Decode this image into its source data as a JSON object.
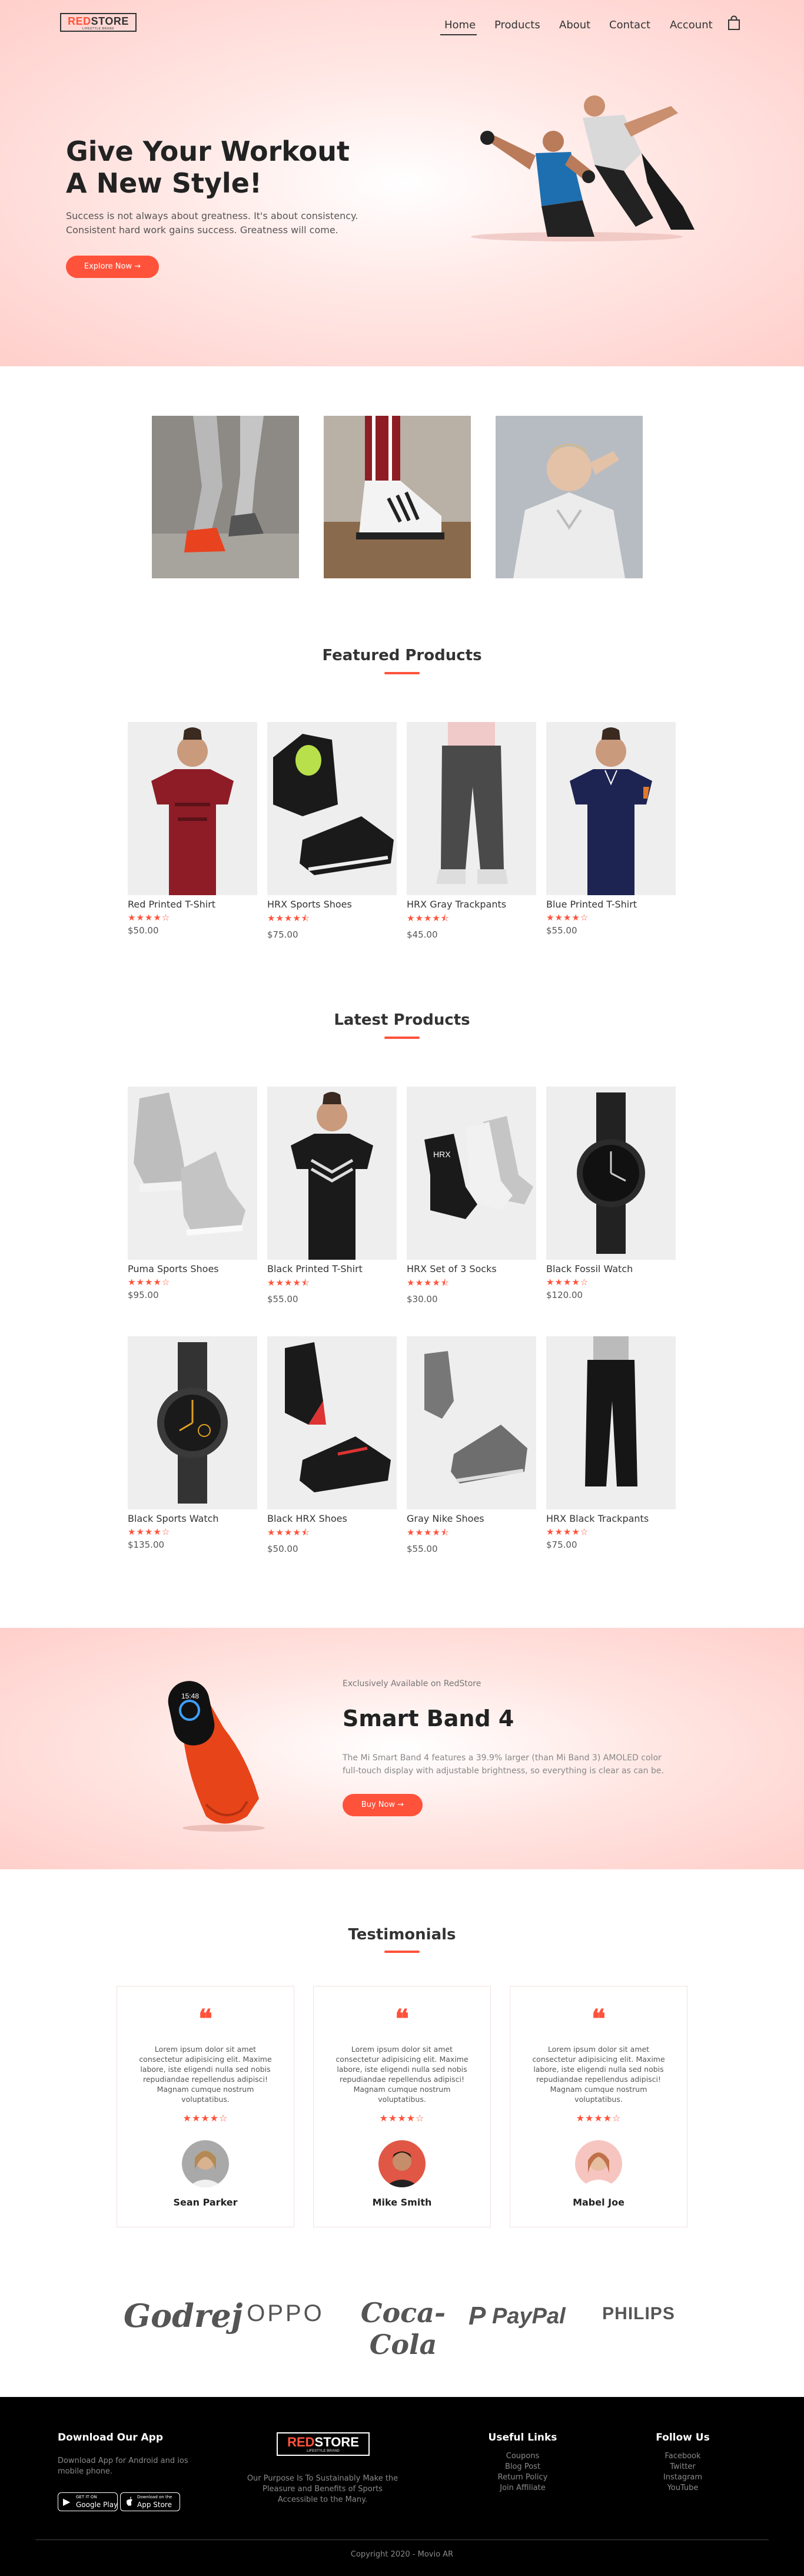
{
  "header": {
    "logo_red": "RED",
    "logo_rest": "STORE",
    "logo_tagline": "LIFESTYLE BRAND",
    "nav": [
      "Home",
      "Products",
      "About",
      "Contact",
      "Account"
    ]
  },
  "hero": {
    "title_line1": "Give Your Workout",
    "title_line2": "A New Style!",
    "description": "Success is not always about greatness. It's about consistency. Consistent hard work gains success. Greatness will come.",
    "button": "Explore Now →"
  },
  "featured": {
    "title": "Featured Products",
    "products": [
      {
        "name": "Red Printed T-Shirt",
        "stars": "★★★★☆",
        "rating": 4,
        "price": "$50.00"
      },
      {
        "name": "HRX Sports Shoes",
        "stars": "★★★★⯪",
        "rating": 4.5,
        "price": "$75.00"
      },
      {
        "name": "HRX Gray Trackpants",
        "stars": "★★★★⯪",
        "rating": 4.5,
        "price": "$45.00"
      },
      {
        "name": "Blue Printed T-Shirt",
        "stars": "★★★★☆",
        "rating": 4,
        "price": "$55.00"
      }
    ]
  },
  "latest": {
    "title": "Latest Products",
    "products": [
      {
        "name": "Puma Sports Shoes",
        "stars": "★★★★☆",
        "rating": 4,
        "price": "$95.00"
      },
      {
        "name": "Black Printed T-Shirt",
        "stars": "★★★★⯪",
        "rating": 4.5,
        "price": "$55.00"
      },
      {
        "name": "HRX Set of 3 Socks",
        "stars": "★★★★⯪",
        "rating": 4.5,
        "price": "$30.00"
      },
      {
        "name": "Black Fossil Watch",
        "stars": "★★★★☆",
        "rating": 4,
        "price": "$120.00"
      },
      {
        "name": "Black Sports Watch",
        "stars": "★★★★☆",
        "rating": 4,
        "price": "$135.00"
      },
      {
        "name": "Black HRX Shoes",
        "stars": "★★★★⯪",
        "rating": 4.5,
        "price": "$50.00"
      },
      {
        "name": "Gray Nike Shoes",
        "stars": "★★★★⯪",
        "rating": 4.5,
        "price": "$55.00"
      },
      {
        "name": "HRX Black Trackpants",
        "stars": "★★★★☆",
        "rating": 4,
        "price": "$75.00"
      }
    ]
  },
  "offer": {
    "eyebrow": "Exclusively Available on RedStore",
    "title": "Smart Band 4",
    "description": "The Mi Smart Band 4 features a 39.9% larger (than Mi Band 3) AMOLED color full-touch display with adjustable brightness, so everything is clear as can be.",
    "button": "Buy Now →"
  },
  "testimonials": {
    "title": "Testimonials",
    "items": [
      {
        "quote": "Lorem ipsum dolor sit amet consectetur adipisicing elit. Maxime labore, iste eligendi nulla sed nobis repudiandae repellendus adipisci! Magnam cumque nostrum voluptatibus.",
        "stars": "★★★★☆",
        "rating": 4,
        "name": "Sean Parker"
      },
      {
        "quote": "Lorem ipsum dolor sit amet consectetur adipisicing elit. Maxime labore, iste eligendi nulla sed nobis repudiandae repellendus adipisci! Magnam cumque nostrum voluptatibus.",
        "stars": "★★★★☆",
        "rating": 4,
        "name": "Mike Smith"
      },
      {
        "quote": "Lorem ipsum dolor sit amet consectetur adipisicing elit. Maxime labore, iste eligendi nulla sed nobis repudiandae repellendus adipisci! Magnam cumque nostrum voluptatibus.",
        "stars": "★★★★☆",
        "rating": 4,
        "name": "Mabel Joe"
      }
    ]
  },
  "brands": [
    "Godrej",
    "OPPO",
    "Coca-Cola",
    "PayPal",
    "PHILIPS"
  ],
  "footer": {
    "download": {
      "title": "Download Our App",
      "text": "Download App for Android and ios mobile phone.",
      "google_small": "GET IT ON",
      "google": "Google Play",
      "apple_small": "Download on the",
      "apple": "App Store"
    },
    "about": "Our Purpose Is To Sustainably Make the Pleasure and Benefits of Sports Accessible to the Many.",
    "links": {
      "title": "Useful Links",
      "items": [
        "Coupons",
        "Blog Post",
        "Return Policy",
        "Join Affiliate"
      ]
    },
    "follow": {
      "title": "Follow Us",
      "items": [
        "Facebook",
        "Twitter",
        "Instagram",
        "YouTube"
      ]
    },
    "copyright": "Copyright 2020 - Movio AR"
  },
  "colors": {
    "accent": "#ff523b",
    "footer_bg": "#000000"
  }
}
